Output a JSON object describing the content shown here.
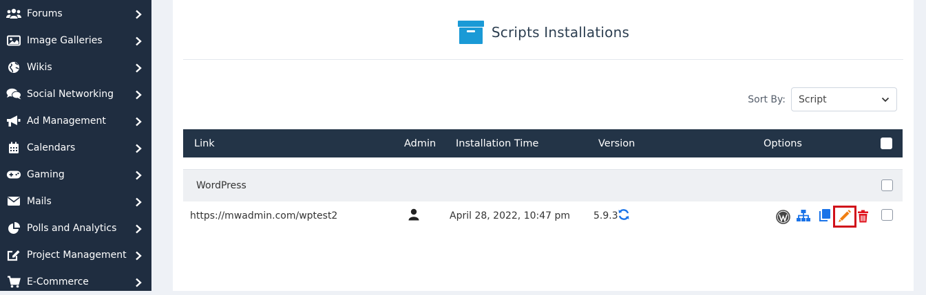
{
  "sidebar": {
    "items": [
      {
        "label": "Forums",
        "icon": "users-icon"
      },
      {
        "label": "Image Galleries",
        "icon": "image-icon"
      },
      {
        "label": "Wikis",
        "icon": "globe-icon"
      },
      {
        "label": "Social Networking",
        "icon": "comments-icon"
      },
      {
        "label": "Ad Management",
        "icon": "bullhorn-icon"
      },
      {
        "label": "Calendars",
        "icon": "calendar-icon"
      },
      {
        "label": "Gaming",
        "icon": "gamepad-icon"
      },
      {
        "label": "Mails",
        "icon": "envelope-icon"
      },
      {
        "label": "Polls and Analytics",
        "icon": "pie-chart-icon"
      },
      {
        "label": "Project Management",
        "icon": "edit-icon"
      },
      {
        "label": "E-Commerce",
        "icon": "cart-icon"
      }
    ]
  },
  "main": {
    "title": "Scripts Installations",
    "title_icon": "archive-box-icon",
    "sort": {
      "label": "Sort By:",
      "value": "Script"
    },
    "table": {
      "headers": {
        "link": "Link",
        "admin": "Admin",
        "installation_time": "Installation Time",
        "version": "Version",
        "options": "Options"
      },
      "group": "WordPress",
      "rows": [
        {
          "link": "https://mwadmin.com/wptest2",
          "admin_icon": "user-icon",
          "installation_time": "April 28, 2022, 10:47 pm",
          "version": "5.9.3"
        }
      ]
    }
  },
  "colors": {
    "sidebar_bg": "#1f2d40",
    "header_bg": "#233447",
    "accent_blue": "#1a73e8",
    "title_icon": "#1a9ad6",
    "edit_orange": "#f07f12",
    "delete_red": "#e0141e",
    "highlight_red": "#d0101a"
  }
}
